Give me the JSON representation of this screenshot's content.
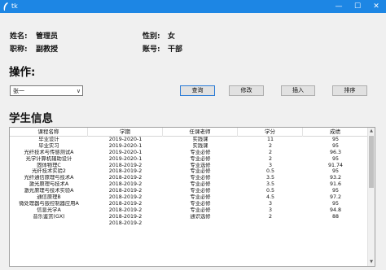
{
  "window": {
    "title": "tk",
    "minimize_glyph": "—",
    "maximize_glyph": "☐",
    "close_glyph": "✕",
    "titlebar_color": "#1d86e4"
  },
  "info": {
    "name_label": "姓名:",
    "name_value": "管理员",
    "title_label": "职称:",
    "title_value": "副教授",
    "gender_label": "性别:",
    "gender_value": "女",
    "account_label": "账号:",
    "account_value": "干部"
  },
  "operations": {
    "heading": "操作:",
    "combo_value": "张一",
    "combo_arrow": "∨",
    "query_label": "查询",
    "edit_label": "修改",
    "insert_label": "插入",
    "sort_label": "排序"
  },
  "table": {
    "heading": "学生信息",
    "columns": [
      "课程名称",
      "学期",
      "任课老师",
      "学分",
      "成绩"
    ],
    "rows": [
      [
        "毕业设计",
        "2019-2020-1",
        "实践课",
        "11",
        "95"
      ],
      [
        "毕业实习",
        "2019-2020-1",
        "实践课",
        "2",
        "95"
      ],
      [
        "光纤技术与传感测试A",
        "2019-2020-1",
        "专业必修",
        "2",
        "96.3"
      ],
      [
        "光学计算机辅助设计",
        "2019-2020-1",
        "专业必修",
        "2",
        "95"
      ],
      [
        "固体物理C",
        "2018-2019-2",
        "专业选修",
        "3",
        "91.74"
      ],
      [
        "光纤技术实验2",
        "2018-2019-2",
        "专业必修",
        "0.5",
        "95"
      ],
      [
        "光纤通信原理与技术A",
        "2018-2019-2",
        "专业必修",
        "3.5",
        "93.2"
      ],
      [
        "激光原理与技术A",
        "2018-2019-2",
        "专业必修",
        "3.5",
        "91.6"
      ],
      [
        "激光原理与技术实验A",
        "2018-2019-2",
        "专业必修",
        "0.5",
        "95"
      ],
      [
        "通信原理B",
        "2018-2019-2",
        "专业必修",
        "4.5",
        "97.2"
      ],
      [
        "微处理器与嵌控制器应用A",
        "2018-2019-2",
        "专业必修",
        "3",
        "95"
      ],
      [
        "信息光学A",
        "2018-2019-2",
        "专业必修",
        "3",
        "94.8"
      ],
      [
        "音乐鉴赏(GX)",
        "2018-2019-2",
        "通识选修",
        "2",
        "88"
      ],
      [
        "",
        "2018-2019-2",
        "",
        "",
        ""
      ]
    ],
    "scroll_up": "▲",
    "scroll_down": "▼"
  }
}
